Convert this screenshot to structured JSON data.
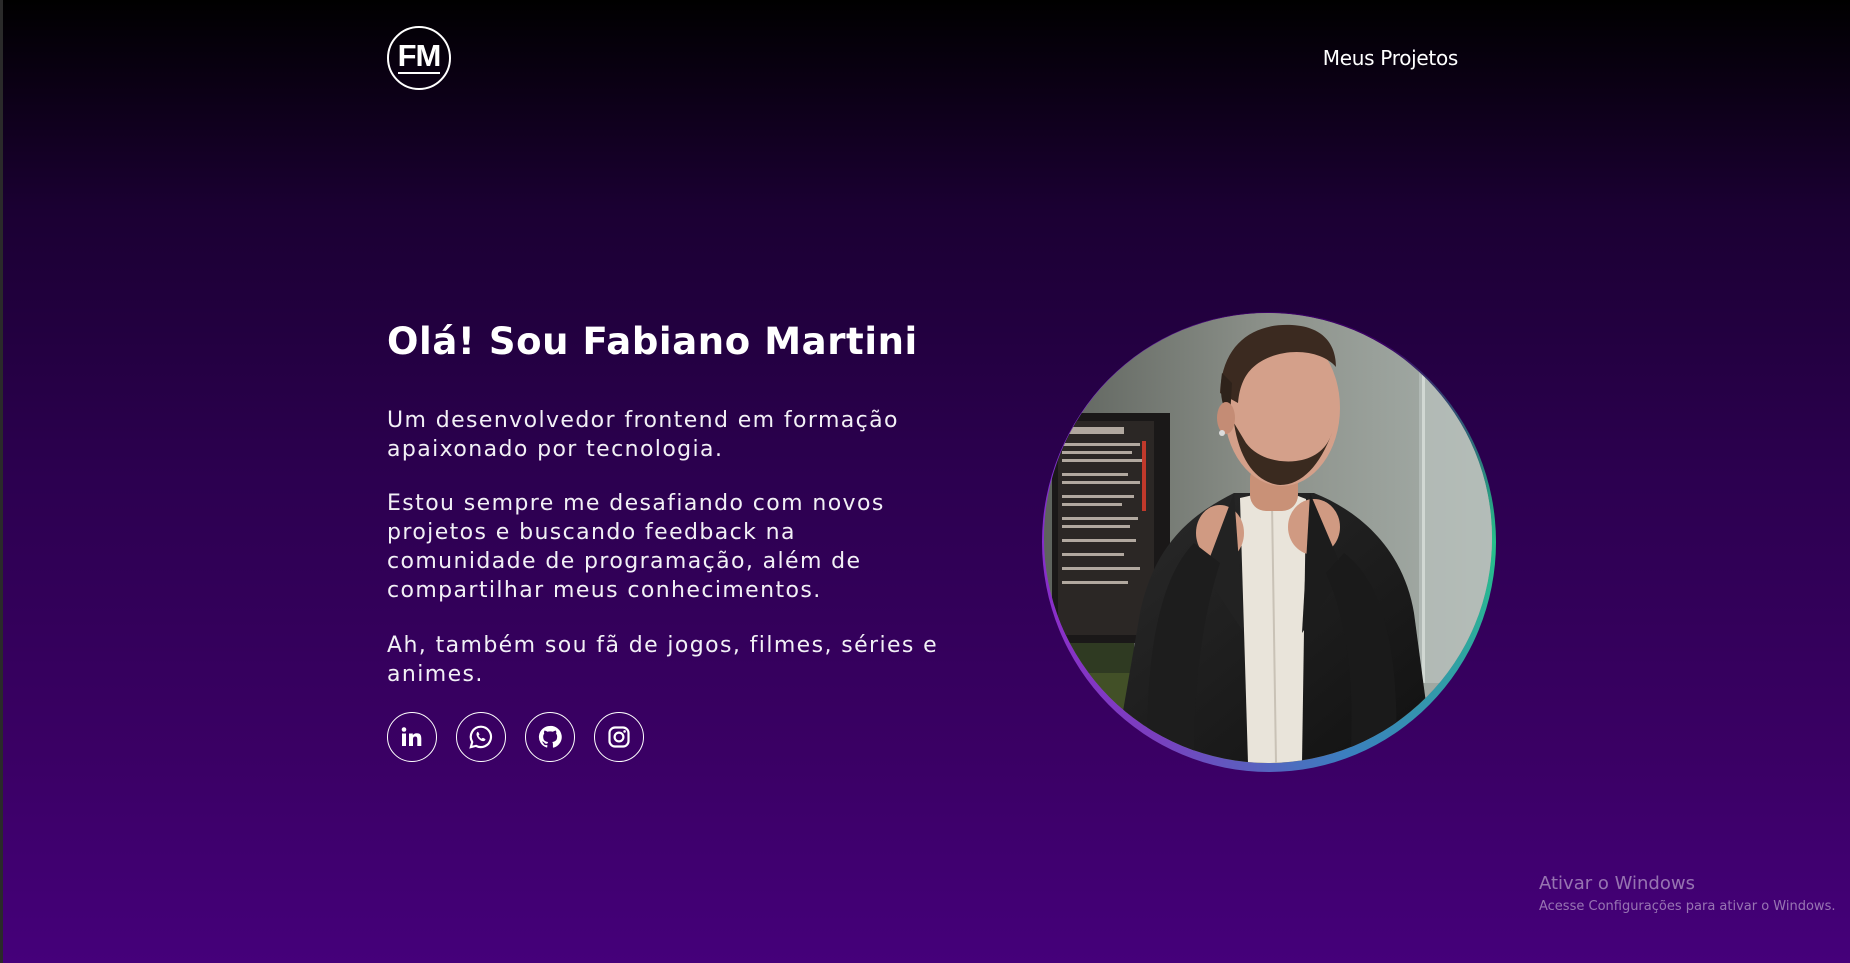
{
  "header": {
    "logo_text": "FM",
    "nav_link": "Meus Projetos"
  },
  "hero": {
    "title": "Olá! Sou Fabiano Martini",
    "paragraphs": [
      "Um desenvolvedor frontend em formação apaixonado por tecnologia.",
      "Estou sempre me desafiando com novos projetos e buscando feedback na comunidade de programação, além de compartilhar meus conhecimentos.",
      "Ah, também sou fã de jogos, filmes, séries e animes."
    ]
  },
  "social": {
    "icons": [
      "linkedin-icon",
      "whatsapp-icon",
      "github-icon",
      "instagram-icon"
    ]
  },
  "profile_photo": {
    "ring_colors": [
      "#25c08a",
      "#3b7fbf",
      "#8a2fc9"
    ]
  },
  "windows_watermark": {
    "title": "Ativar o Windows",
    "subtitle": "Acesse Configurações para ativar o Windows."
  },
  "colors": {
    "background_top": "#000000",
    "background_bottom": "#45007a",
    "text": "#ffffff"
  }
}
